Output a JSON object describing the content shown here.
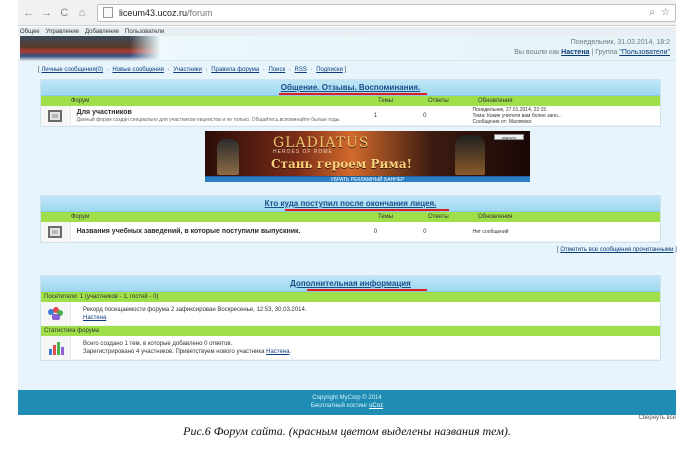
{
  "browser": {
    "url_host": "liceum43.ucoz.ru",
    "url_path": "/forum"
  },
  "topmenu": [
    "Общее",
    "Управление",
    "Добавление",
    "Пользователи"
  ],
  "header": {
    "date_text": "Понедельник, 31.03.2014, 18:2",
    "you_are_logged_in": "Вы вошли как",
    "user_name": "Настена",
    "group_label": "Группа",
    "group_value": "\"Пользователи\"",
    "right_sep": "|"
  },
  "navlinks": {
    "bracket_open": "[",
    "bracket_close": "]",
    "items": [
      "Личные сообщения(0)",
      "Новые сообщения",
      "Участники",
      "Правила форума",
      "Поиск",
      "RSS",
      "Подписки"
    ],
    "separator": "·"
  },
  "section1": {
    "title": "Общение. Отзывы. Воспоминания.",
    "headers": {
      "forum": "Форум",
      "topics": "Темы",
      "replies": "Ответы",
      "updates": "Обновления"
    },
    "row": {
      "title": "Для участников",
      "description": "Данный форум создан специально для участников-лицеистов и не только. Общайтесь,вспоминайте былые годы.",
      "topics": "1",
      "replies": "0",
      "updates_line1": "Понедельник, 27.01.2014, 22:15",
      "updates_line2": "Тема: Какие учителя вам более запо...",
      "updates_line3": "Сообщение от: Маляевск"
    }
  },
  "banner": {
    "logo": "GLADIATUS",
    "sub": "HEROES OF ROME",
    "slogan": "Стань героем Рима!",
    "tiny_button": "закрыть",
    "bottom_bar": "УБРАТЬ РЕКЛАМНЫЙ БАННЕР"
  },
  "section2": {
    "title": "Кто куда поступил после окончания лицея.",
    "headers": {
      "forum": "Форум",
      "topics": "Темы",
      "replies": "Ответы",
      "updates": "Обновления"
    },
    "row": {
      "title": "Названия учебных заведений, в которые поступили выпускник.",
      "topics": "0",
      "replies": "0",
      "updates": "Нет сообщений"
    }
  },
  "mark_all_read": {
    "bracket_open": "[",
    "bracket_close": "]",
    "label": "Отметить все сообщения прочитанными"
  },
  "info": {
    "title": "Дополнительная информация",
    "visitors": "Посетители: 1  (участников - 1, гостей - 0)",
    "record_text": "Рекорд посещаемости форума 2 зафиксирован Воскресенье, 12:53, 30.03.2014.",
    "record_user": "Настена",
    "stats_label": "Статистика форума",
    "stats_line1": "Всего создано 1 тем, в которые добавлено 0 ответов.",
    "stats_line2_prefix": "Зарегистрировано 4 участников. Приветствуем нового участника",
    "stats_line2_user": "Настена",
    "stats_line2_suffix": "."
  },
  "footer": {
    "copyright": "Copyright MyCorp © 2014",
    "hosting_text": "Бесплатный хостинг",
    "hosting_link": "uCoz",
    "right_text": "Свернуть все"
  },
  "caption": "Рис.6 Форум сайта. (красным цветом выделены названия тем)."
}
